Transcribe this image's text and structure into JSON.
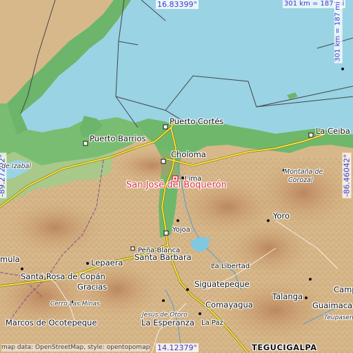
{
  "coords": {
    "north": "16.83399°",
    "south": "14.12379°",
    "west": "-89.27292°",
    "east": "-86.46042°"
  },
  "scale": {
    "horizontal": "301 km = 187 mi",
    "vertical": "301 km = 187 mi"
  },
  "highlight": {
    "name": "San José del Boquerón",
    "color": "#d8303a"
  },
  "places": {
    "puerto_cortes": "Puerto Cortés",
    "puerto_barrios": "Puerto Barrios",
    "la_ceiba": "La Ceiba",
    "choloma": "Choloma",
    "lima": "Lima",
    "montana": "Montaña de",
    "corozal": "Corozal",
    "izabal": "de Izabal",
    "yoro": "Yoro",
    "yojoa": "Yojoa",
    "pena_blanca": "Peña Blanca",
    "santa_barbara": "Santa Barbara",
    "lepaera": "Lepaera",
    "santa_rosa": "Santa Rosa de Copán",
    "gracias": "Gracias",
    "la_libertad": "La Libertad",
    "siguatepeque": "Siguatepeque",
    "comayagua": "Comayagua",
    "talanga": "Talanga",
    "guaimaca": "Guaimaca",
    "camp": "Camp",
    "teupasen": "Teupasen",
    "cerro_las_minas": "Cerro Las Minas",
    "marcos": "Marcos de Ocotepeque",
    "jesus_otoro": "Jesús de Otoro",
    "la_esperanza": "La Esperanza",
    "la_paz": "La Paz",
    "tegucigalpa": "TEGUCIGALPA",
    "mula": "mula"
  },
  "credit": "map data: OpenStreetMap, style: opentopomap"
}
